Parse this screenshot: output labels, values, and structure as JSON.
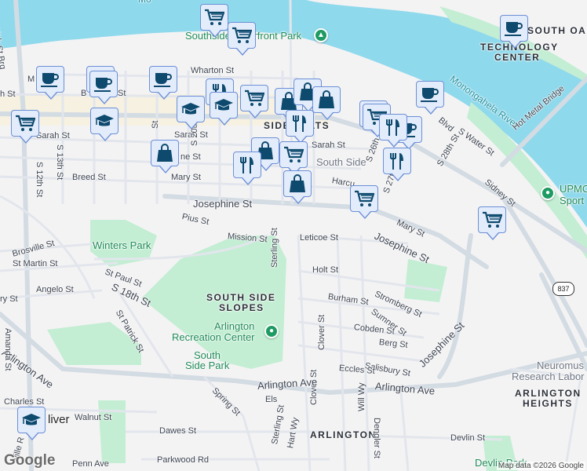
{
  "map": {
    "water": {
      "river": "Monongahela River",
      "top_partial": "Mo"
    },
    "neighborhoods": {
      "south_side": "SIDE FLATS",
      "south_oakland": "SOUTH OAK",
      "technology_center_1": "TECHNOLOGY",
      "technology_center_2": "CENTER",
      "south_side_slopes_1": "SOUTH SIDE",
      "south_side_slopes_2": "SLOPES",
      "arlington": "ARLINGTON",
      "arlington_heights_1": "ARLINGTON",
      "arlington_heights_2": "HEIGHTS",
      "mt_oliver": "liver"
    },
    "parks": {
      "waterfront": "Southside Riverfront Park",
      "winters": "Winters Park",
      "arlington_rec_1": "Arlington",
      "arlington_rec_2": "Recreation Center",
      "south_side_park_1": "South",
      "south_side_park_2": "Side Park",
      "upmc_1": "UPMC",
      "upmc_2": "Sport",
      "neuro_1": "Neuromus",
      "neuro_2": "Research Labor",
      "devlin": "Devlin Park",
      "south_side_poi": "South Side"
    },
    "streets": {
      "tenth_brg": "10th St Brg",
      "wharton": "Wharton St",
      "sarah_w": "Sarah St",
      "sarah_e": "Sarah St",
      "breed": "Breed St",
      "mary_w": "Mary St",
      "mary_e": "Mary St",
      "jane": "ne St",
      "josephine_w": "Josephine St",
      "josephine_e": "Josephine St",
      "josephine_s": "Josephine St",
      "pius": "Pius St",
      "mission": "Mission St",
      "s12": "S 12th St",
      "s13": "S 13th St",
      "s20": "S 20th St",
      "s26": "S 26th St",
      "s27": "S 27th St",
      "s28": "S 28th St",
      "swater": "S Water St",
      "sidney": "Sidney St",
      "hotmetal": "Hot Metal Bridge",
      "blvd": "Blvd",
      "harcum": "Harcu",
      "leticoe": "Leticoe St",
      "holt": "Holt St",
      "burham": "Burham St",
      "stromberg": "Stromberg St",
      "sumner": "Sumner St",
      "cobden": "Cobden St",
      "berg": "Berg St",
      "clover_n": "Clover St",
      "clover_s": "Clover St",
      "salisbury": "Salisbury St",
      "eccles": "Eccles St",
      "arlington_w": "Arlington Ave",
      "arlington_m": "Arlington Ave",
      "arlington_e": "Arlington Ave",
      "will": "Will Wy",
      "dengler": "Dengler St",
      "devlin": "Devlin St",
      "sterling_n": "Sterling St",
      "sterling_s": "Sterling St",
      "hart": "Hart Wy",
      "els": "Els",
      "spring": "Spring St",
      "dawes": "Dawes St",
      "walnut": "Walnut St",
      "parkwood": "Parkwood Rd",
      "penn": "Penn Ave",
      "charles": "Charles St",
      "amanda": "Amanda St",
      "angelo": "Angelo St",
      "ry": "ry St",
      "brosville": "Brosville St",
      "stmartin": "St Martin St",
      "stpaul": "St Paul St",
      "s18": "S 18th St",
      "stpatrick": "St Patrick St",
      "ville": "ville R",
      "m": "M",
      "h": "h St",
      "b": "B",
      "st_frag": "St",
      "carson": "St"
    },
    "route_shield": "837",
    "logo": "Google",
    "attribution": "Map data ©2026 Google"
  },
  "markers": [
    {
      "icon": "shopping-cart"
    },
    {
      "icon": "shopping-cart"
    },
    {
      "icon": "coffee"
    },
    {
      "icon": "coffee"
    },
    {
      "icon": "coffee"
    },
    {
      "icon": "coffee"
    },
    {
      "icon": "graduation-cap"
    },
    {
      "icon": "shopping-cart"
    },
    {
      "icon": "restaurant"
    },
    {
      "icon": "graduation-cap"
    },
    {
      "icon": "graduation-cap"
    },
    {
      "icon": "shopping-cart"
    },
    {
      "icon": "shopping-bag"
    },
    {
      "icon": "shopping-bag"
    },
    {
      "icon": "shopping-bag"
    },
    {
      "icon": "restaurant"
    },
    {
      "icon": "shopping-bag"
    },
    {
      "icon": "shopping-bag"
    },
    {
      "icon": "restaurant"
    },
    {
      "icon": "shopping-cart"
    },
    {
      "icon": "shopping-bag"
    },
    {
      "icon": "coffee"
    },
    {
      "icon": "coffee"
    },
    {
      "icon": "coffee"
    },
    {
      "icon": "shopping-cart"
    },
    {
      "icon": "coffee"
    },
    {
      "icon": "restaurant"
    },
    {
      "icon": "restaurant"
    },
    {
      "icon": "shopping-cart"
    },
    {
      "icon": "shopping-cart"
    },
    {
      "icon": "graduation-cap"
    }
  ],
  "colors": {
    "water": "#8fd9ec",
    "park": "#c3eed3",
    "marker_bg": "#e3ecfb",
    "marker_icon": "#0d4a6e",
    "poi": "#1e9b62"
  }
}
